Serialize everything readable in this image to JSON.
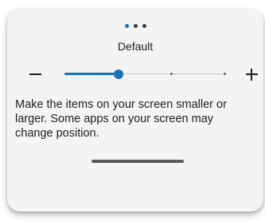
{
  "font_size_panel": {
    "page_indicator": {
      "count": 3,
      "active_index": 0
    },
    "title": "Default",
    "decrease_icon": "minus-icon",
    "increase_icon": "plus-icon",
    "slider": {
      "steps": 4,
      "selected_step": 1
    },
    "description": "Make the items on your screen smaller or larger. Some apps on your screen may change position."
  },
  "colors": {
    "accent": "#1a73b5",
    "card_background": "#f4f4f4",
    "text": "#202124",
    "handle": "#5a5a5a"
  }
}
